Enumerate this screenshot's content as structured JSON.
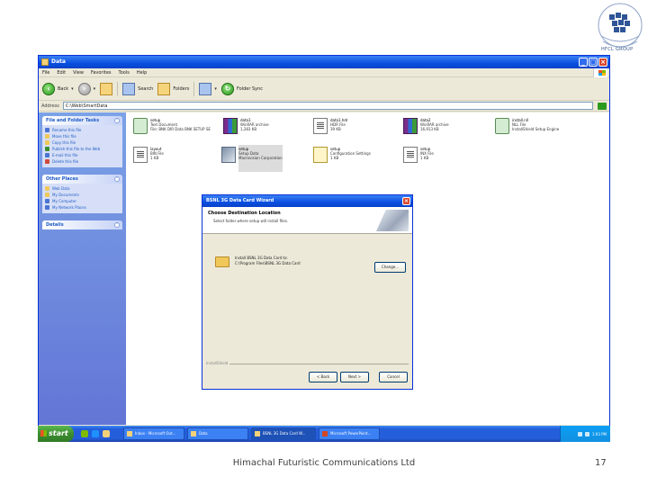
{
  "logo": {
    "text": "HFCL GROUP"
  },
  "window": {
    "title": "Data",
    "menu": [
      "File",
      "Edit",
      "View",
      "Favorites",
      "Tools",
      "Help"
    ],
    "toolbar": {
      "back": "Back",
      "search": "Search",
      "folders": "Folders",
      "sync": "Folder Sync"
    },
    "address_label": "Address",
    "address_value": "C:\\Web\\SmartData"
  },
  "left_pane": {
    "groups": [
      {
        "title": "File and Folder Tasks",
        "items": [
          "Rename this file",
          "Move this file",
          "Copy this file",
          "Publish this file to the Web",
          "E-mail this file",
          "Delete this file"
        ]
      },
      {
        "title": "Other Places",
        "items": [
          "Web Data",
          "My Documents",
          "My Computer",
          "My Network Places"
        ]
      },
      {
        "title": "Details",
        "items": []
      }
    ]
  },
  "files": [
    {
      "name": "setup",
      "line2": "Text Document",
      "line3": "File: BNK DIR Data BNK SETUP SE"
    },
    {
      "name": "data1",
      "line2": "WinRAR archive",
      "line3": "1,283 KB"
    },
    {
      "name": "data1.hdr",
      "line2": "HDR File",
      "line3": "39 KB"
    },
    {
      "name": "data2",
      "line2": "WinRAR archive",
      "line3": "16,913 KB"
    },
    {
      "name": "install.nll",
      "line2": "NLL File",
      "line3": "InstallShield Setup Engine"
    },
    {
      "name": "layout",
      "line2": "BIN File",
      "line3": "1 KB"
    },
    {
      "name": "setup",
      "line2": "Setup Data",
      "line3": "Macrovision Corporation"
    },
    {
      "name": "setup",
      "line2": "Configuration Settings",
      "line3": "1 KB"
    },
    {
      "name": "setup",
      "line2": "INX File",
      "line3": "1 KB"
    }
  ],
  "dialog": {
    "title": "BSNL 3G Data Card Wizard",
    "heading": "Choose Destination Location",
    "subheading": "Select folder where setup will install files.",
    "dest_line1": "Install BSNL 3G Data Card to:",
    "dest_line2": "C:\\Program Files\\BSNL 3G Data Card",
    "change_label": "Change...",
    "footer_label": "InstallShield",
    "buttons": [
      "< Back",
      "Next >",
      "Cancel"
    ]
  },
  "taskbar": {
    "start_label": "start",
    "tasks": [
      "Inbox - Microsoft Out...",
      "Data",
      "BSNL 3G Data Card W...",
      "Microsoft PowerPoint..."
    ],
    "clock": "1:03 PM"
  },
  "slide": {
    "footer": "Himachal Futuristic Communications Ltd",
    "page": "17"
  },
  "colors": {
    "xp_blue": "#0a4ee0",
    "task_pane": "#7ba2e7",
    "start_green": "#3c8d2f"
  }
}
